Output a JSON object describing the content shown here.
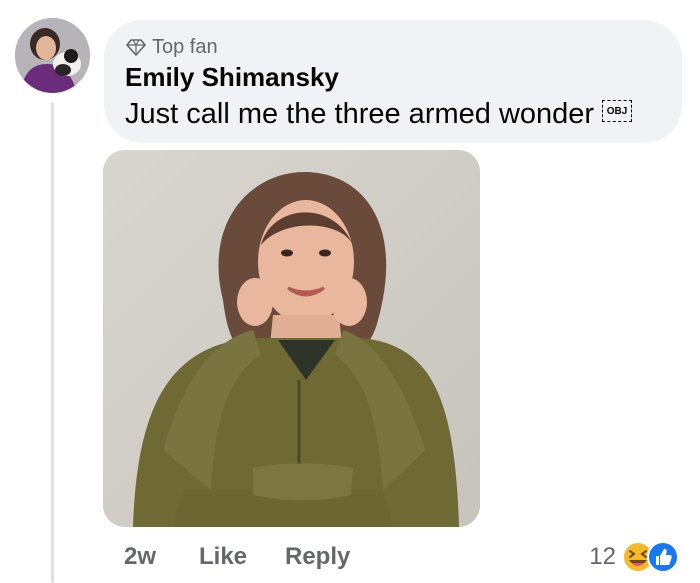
{
  "comment": {
    "badge_label": "Top fan",
    "author": "Emily Shimansky",
    "text": "Just call me the three armed wonder",
    "object_marker": "OBJ"
  },
  "actions": {
    "time": "2w",
    "like_label": "Like",
    "reply_label": "Reply"
  },
  "reactions": {
    "count": "12",
    "icons": [
      "laugh-emoji-icon",
      "like-thumb-icon"
    ]
  },
  "colors": {
    "bubble": "#f0f2f5",
    "meta_gray": "#65676b",
    "like_blue": "#1877f2",
    "laugh_yellow": "#f7b928"
  }
}
